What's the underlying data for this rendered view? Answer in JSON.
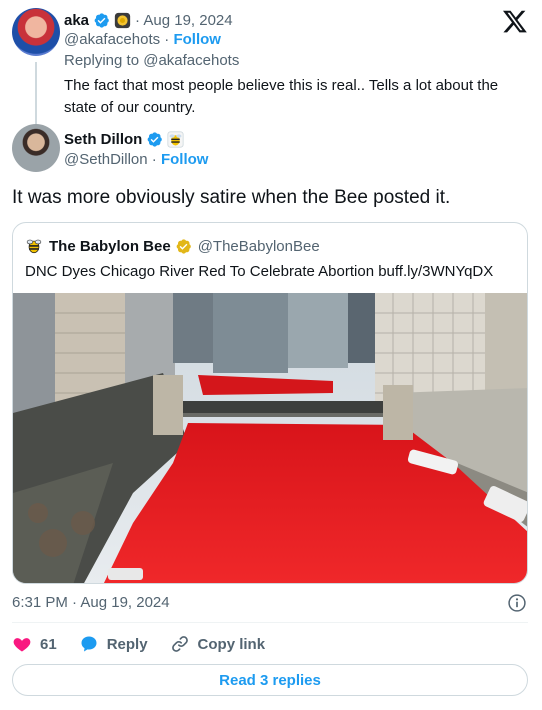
{
  "parent_tweet": {
    "name": "aka",
    "date": "Aug 19, 2024",
    "handle": "@akafacehots",
    "follow_label": "Follow",
    "replying_to": "Replying to @akafacehots",
    "text": "The fact that most people believe this is real.. Tells a lot about the state of our country."
  },
  "main_tweet": {
    "name": "Seth Dillon",
    "handle": "@SethDillon",
    "follow_label": "Follow",
    "text": "It was more obviously satire when the Bee posted it.",
    "timestamp": "6:31 PM · Aug 19, 2024"
  },
  "quoted_tweet": {
    "name": "The Babylon Bee",
    "handle": "@TheBabylonBee",
    "text": "DNC Dyes Chicago River Red To Celebrate Abortion buff.ly/3WNYqDX"
  },
  "actions": {
    "like_count": "61",
    "reply_label": "Reply",
    "copy_link_label": "Copy link"
  },
  "read_replies_label": "Read 3 replies",
  "separators": {
    "dot": "·"
  },
  "colors": {
    "accent": "#1d9bf0",
    "like": "#f91880",
    "verified_blue": "#1d9bf0",
    "verified_gold": "#e2b719",
    "river_red": "#e81e1e"
  },
  "icons": [
    "x-logo-icon",
    "verified-badge-icon",
    "gold-verified-badge-icon",
    "bee-icon",
    "heart-icon",
    "reply-bubble-icon",
    "link-icon",
    "info-icon"
  ]
}
